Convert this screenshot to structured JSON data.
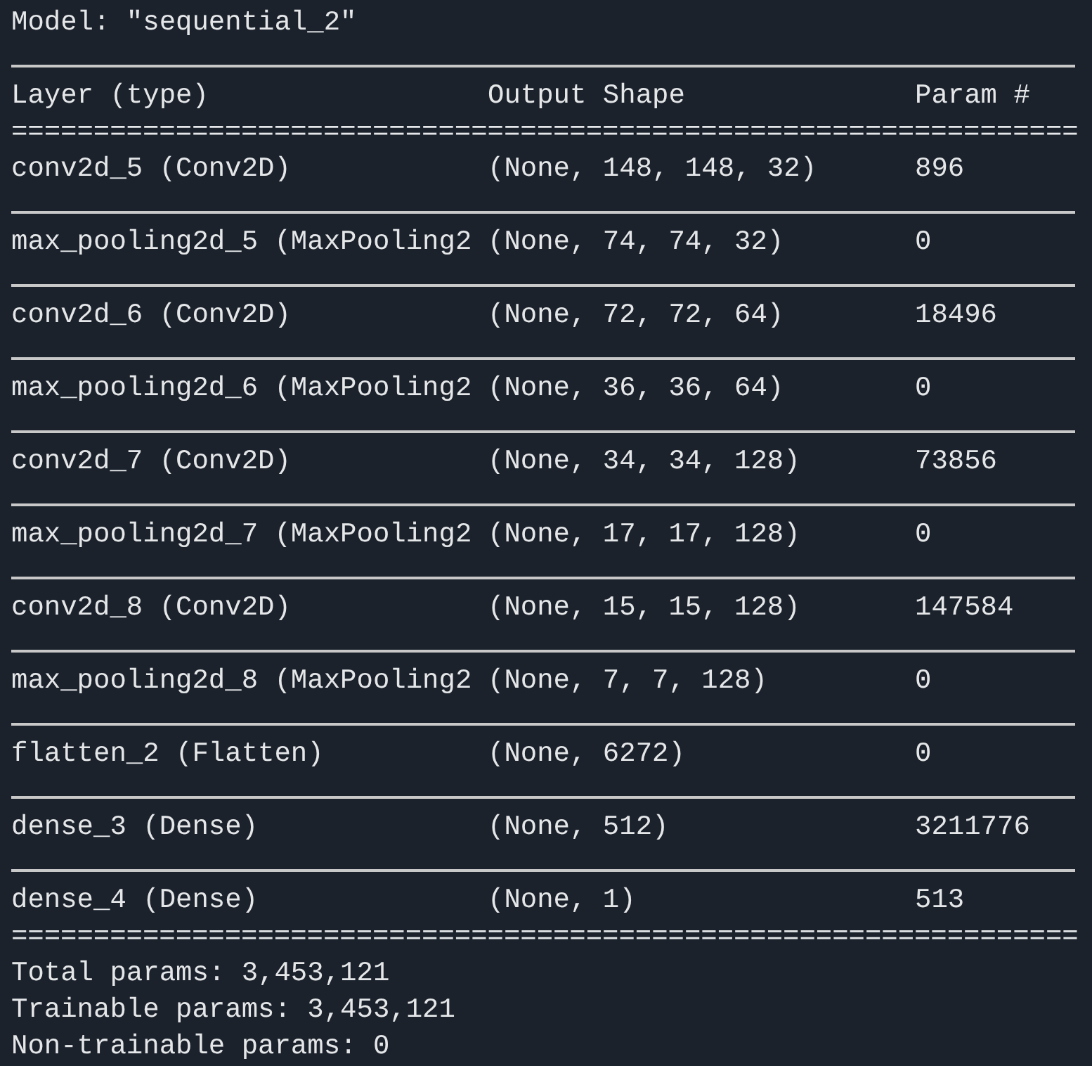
{
  "model_title": "Model: \"sequential_2\"",
  "columns": [
    "Layer (type)",
    "Output Shape",
    "Param #"
  ],
  "header_rule": "=================================================================",
  "rows": [
    {
      "layer": "conv2d_5 (Conv2D)",
      "shape": "(None, 148, 148, 32)",
      "params": "896"
    },
    {
      "layer": "max_pooling2d_5 (MaxPooling2",
      "shape": "(None, 74, 74, 32)",
      "params": "0"
    },
    {
      "layer": "conv2d_6 (Conv2D)",
      "shape": "(None, 72, 72, 64)",
      "params": "18496"
    },
    {
      "layer": "max_pooling2d_6 (MaxPooling2",
      "shape": "(None, 36, 36, 64)",
      "params": "0"
    },
    {
      "layer": "conv2d_7 (Conv2D)",
      "shape": "(None, 34, 34, 128)",
      "params": "73856"
    },
    {
      "layer": "max_pooling2d_7 (MaxPooling2",
      "shape": "(None, 17, 17, 128)",
      "params": "0"
    },
    {
      "layer": "conv2d_8 (Conv2D)",
      "shape": "(None, 15, 15, 128)",
      "params": "147584"
    },
    {
      "layer": "max_pooling2d_8 (MaxPooling2",
      "shape": "(None, 7, 7, 128)",
      "params": "0"
    },
    {
      "layer": "flatten_2 (Flatten)",
      "shape": "(None, 6272)",
      "params": "0"
    },
    {
      "layer": "dense_3 (Dense)",
      "shape": "(None, 512)",
      "params": "3211776"
    },
    {
      "layer": "dense_4 (Dense)",
      "shape": "(None, 1)",
      "params": "513"
    }
  ],
  "footer_rule": "=================================================================",
  "totals": [
    "Total params: 3,453,121",
    "Trainable params: 3,453,121",
    "Non-trainable params: 0"
  ]
}
